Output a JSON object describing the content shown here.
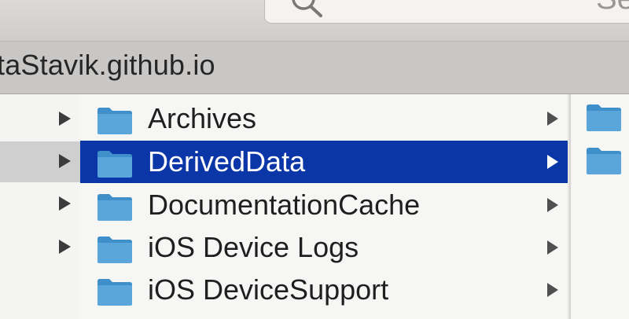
{
  "search": {
    "placeholder": "Se"
  },
  "pathbar": {
    "title": "taStavik.github.io"
  },
  "rows": [
    {
      "label": "Archives",
      "selected": false
    },
    {
      "label": "DerivedData",
      "selected": true
    },
    {
      "label": "DocumentationCache",
      "selected": false
    },
    {
      "label": "iOS Device Logs",
      "selected": false
    },
    {
      "label": "iOS DeviceSupport",
      "selected": false
    }
  ],
  "icons": {
    "folder": "folder-icon",
    "disclosure": "disclosure-triangle-icon",
    "search": "magnifier-icon"
  },
  "colors": {
    "selection": "#0b36a8",
    "folder": "#5aa6da",
    "folder_dark": "#3f8fcb"
  }
}
